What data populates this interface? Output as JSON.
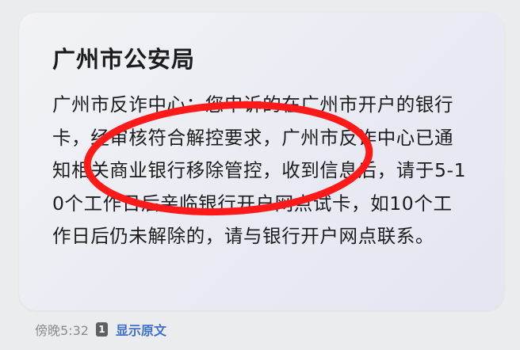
{
  "message": {
    "sender": "广州市公安局",
    "body": "广州市反诈中心：您申诉的在广州市开户的银行卡，经审核符合解控要求，广州市反诈中心已通知相关商业银行移除管控，收到信息后，请于5-10个工作日后亲临银行开户网点试卡，如10个工作日后仍未解除的，请与银行开户网点联系。"
  },
  "footer": {
    "time": "傍晚5:32",
    "sim_slot": "1",
    "show_original_label": "显示原文"
  },
  "colors": {
    "annotation_circle": "#ff1a1a",
    "link": "#3f6fc9"
  }
}
